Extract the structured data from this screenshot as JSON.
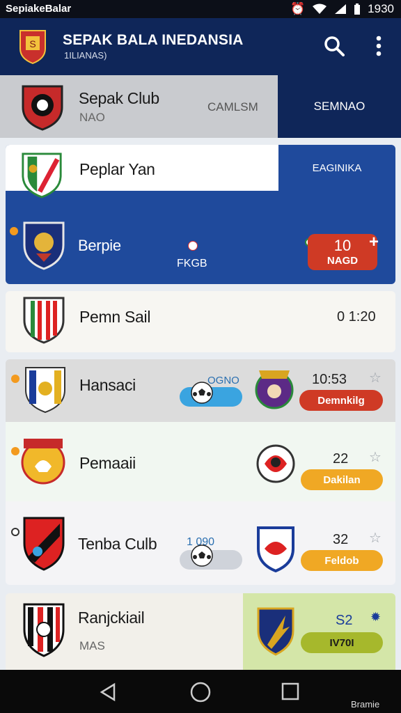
{
  "status_bar": {
    "app_name": "SepiakeBalar",
    "time": "1930"
  },
  "header": {
    "title": "SEPAK BALA INEDANSIA",
    "subtitle": "1ILIANAS)"
  },
  "tabs": {
    "club_name": "Sepak Club",
    "club_sub": "NAO",
    "middle_label": "CAMLSM",
    "right_tab": "SEMNAO"
  },
  "matches": [
    {
      "name": "Peplar Yan",
      "badge": "EAGINIKA"
    },
    {
      "name": "Berpie",
      "center_label": "FKGB",
      "score": "10",
      "status": "NAGD"
    },
    {
      "name": "Pemn Sail",
      "time": "0 1:20"
    },
    {
      "name": "Hansaci",
      "progress_label": "OGNO",
      "time": "10:53",
      "status": "Demnkilg"
    },
    {
      "name": "Pemaaii",
      "time": "22",
      "status": "Dakilan"
    },
    {
      "name": "Tenba Culb",
      "progress_label": "1 090",
      "time": "32",
      "status": "Feldob"
    },
    {
      "name": "Ranjckiail",
      "sub": "MAS",
      "time": "S2",
      "status": "IV70I"
    }
  ],
  "footer": {
    "corner_text": "Bramie"
  },
  "icons": [
    "search-icon",
    "menu-dots-icon",
    "alarm-icon",
    "wifi-icon",
    "signal-icon",
    "battery-icon",
    "star-icon",
    "soccer-ball-icon",
    "back-icon",
    "home-icon",
    "recents-icon"
  ],
  "colors": {
    "navy": "#0f2659",
    "blue": "#1f4a9c",
    "red": "#cf3a25",
    "orange": "#f0a824",
    "olive": "#a6b82c",
    "light_blue": "#3aa4e0"
  }
}
